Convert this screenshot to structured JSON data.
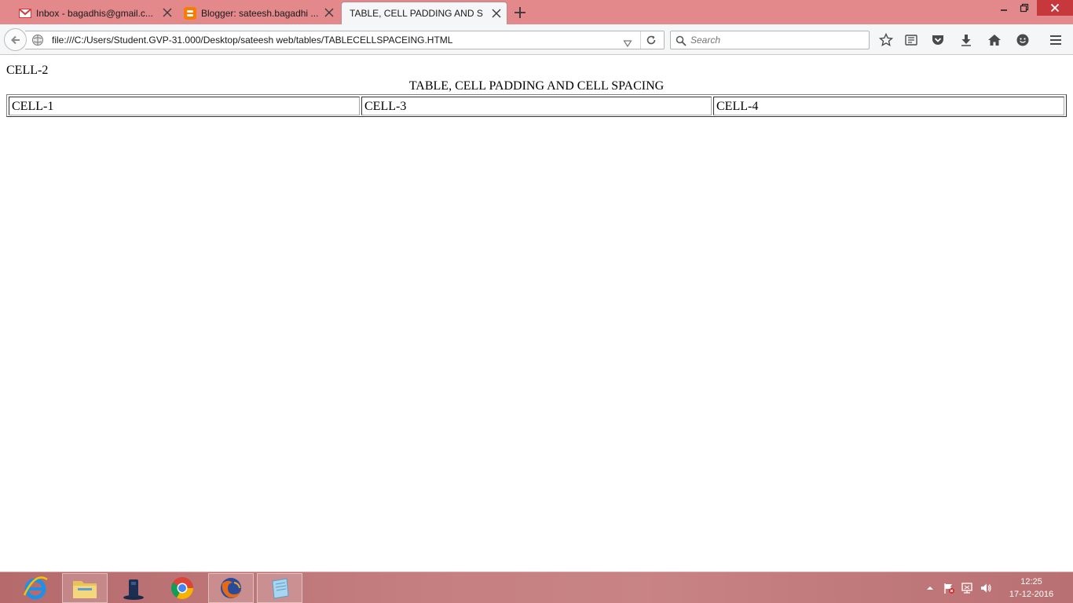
{
  "browser": {
    "tabs": [
      {
        "title": "Inbox - bagadhis@gmail.c...",
        "icon": "gmail-icon",
        "active": false
      },
      {
        "title": "Blogger: sateesh.bagadhi ...",
        "icon": "blogger-icon",
        "active": false
      },
      {
        "title": "TABLE, CELL PADDING AND S...",
        "icon": "",
        "active": true
      }
    ],
    "url": "file:///C:/Users/Student.GVP-31.000/Desktop/sateesh web/tables/TABLECELLSPACEING.HTML",
    "search_placeholder": "Search"
  },
  "page": {
    "loose_cell": "CELL-2",
    "caption": "TABLE, CELL PADDING AND CELL SPACING",
    "cells": [
      "CELL-1",
      "CELL-3",
      "CELL-4"
    ]
  },
  "taskbar": {
    "apps": [
      "internet-explorer-icon",
      "file-explorer-icon",
      "media-app-icon",
      "chrome-icon",
      "firefox-icon",
      "notepad-icon"
    ],
    "clock": {
      "time": "12:25",
      "date": "17-12-2016"
    }
  },
  "colors": {
    "titlebar": "#e3898c",
    "toolbar": "#f5f6f7",
    "taskbar": "#c57f80"
  }
}
